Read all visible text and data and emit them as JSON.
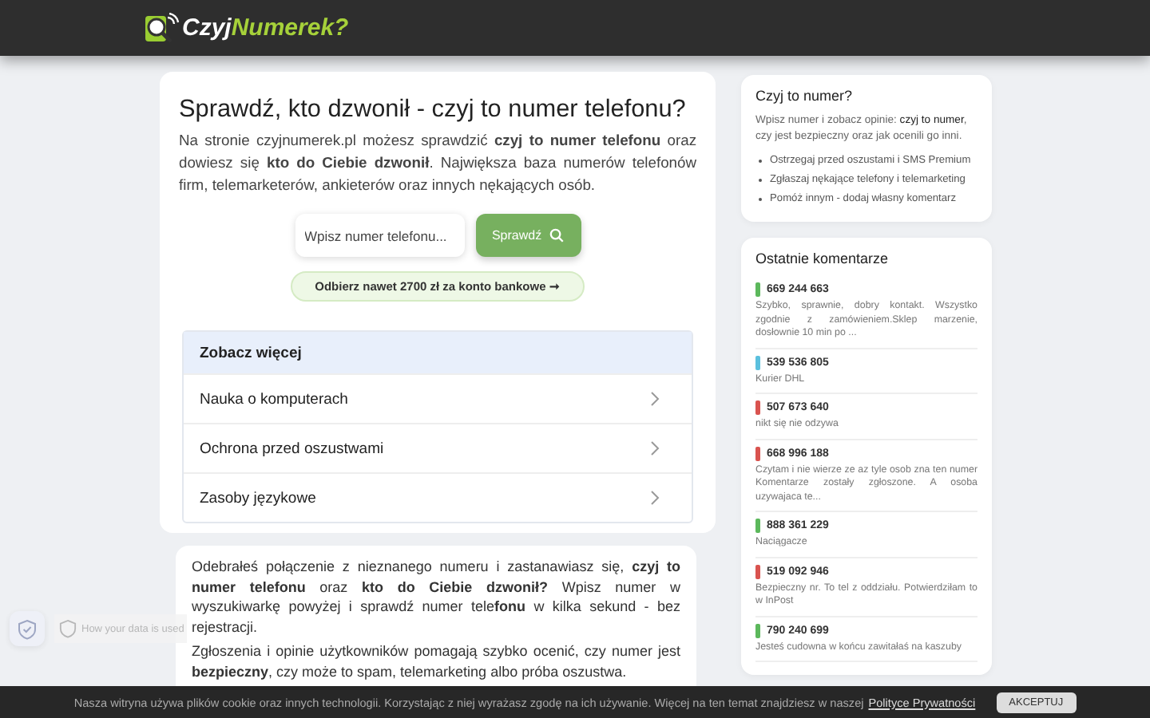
{
  "header": {
    "logo": {
      "part1": "Czyj",
      "part2": "Numerek?"
    }
  },
  "hero": {
    "title": "Sprawdź, kto dzwonił - czyj to numer telefonu?",
    "intro": "Na stronie czyjnumerek.pl możesz sprawdzić **czyj to numer telefonu** oraz dowiesz się **kto do Ciebie dzwonił**. Największa baza numerów telefonów firm, telemarketerów, ankieterów oraz innych nękających osób.",
    "search": {
      "placeholder": "Wpisz numer telefonu..."
    },
    "search_button": "Sprawdź",
    "promo": "Odbierz nawet 2700 zł za konto bankowe ➞"
  },
  "see_more": {
    "title": "Zobacz więcej",
    "items": [
      "Nauka o komputerach",
      "Ochrona przed oszustwami",
      "Zasoby językowe"
    ]
  },
  "article": {
    "paragraphs": [
      "Odebrałeś połączenie z nieznanego numeru i zastanawiasz się, **czyj to numer telefonu** oraz **kto do Ciebie dzwonił?** Wpisz numer w wyszukiwarkę powyżej i sprawdź numer tele**fonu** w kilka sekund - bez rejestracji.",
      "Zgłoszenia i opinie użytkowników pomagają szybko ocenić, czy numer jest **bezpieczny**, czy może to spam, telemarketing albo próba oszustwa."
    ]
  },
  "sidebar": {
    "info": {
      "title": "Czyj to numer?",
      "text": "Wpisz numer i zobacz opinie: **czyj to numer**, czy jest bezpieczny oraz jak ocenili go inni.",
      "bullets": [
        "Ostrzegaj przed oszustami i SMS Premium",
        "Zgłaszaj nękające telefony i telemarketing",
        "Pomóż innym - dodaj własny komentarz"
      ]
    },
    "comments": {
      "title": "Ostatnie komentarze",
      "items": [
        {
          "number": "669 244 663",
          "color": "#5cb85c",
          "text": "Szybko, sprawnie, dobry kontakt. Wszystko zgodnie z zamówieniem.Sklep marzenie, dosłownie 10 min po ..."
        },
        {
          "number": "539 536 805",
          "color": "#5bc0de",
          "text": "Kurier DHL"
        },
        {
          "number": "507 673 640",
          "color": "#d9534f",
          "text": "nikt się nie odzywa"
        },
        {
          "number": "668 996 188",
          "color": "#d9534f",
          "text": "Czytam i nie wierze ze az tyle osob zna ten numer Komentarze zostały zgłoszone. A osoba uzywajaca te..."
        },
        {
          "number": "888 361 229",
          "color": "#5cb85c",
          "text": "Naciągacze"
        },
        {
          "number": "519 092 946",
          "color": "#d9534f",
          "text": "Bezpieczny nr. To tel z oddziału. Potwierdziłam to w InPost"
        },
        {
          "number": "790 240 699",
          "color": "#5cb85c",
          "text": "Jesteś cudowna w końcu zawitałaś na kaszuby"
        }
      ]
    }
  },
  "privacy_popup": {
    "title": "How your data is used"
  },
  "cookie_bar": {
    "text": "Nasza witryna używa plików cookie oraz innych technologii. Korzystając z niej wyrażasz zgodę na ich używanie. Więcej na ten temat znajdziesz w naszej",
    "link": "Polityce Prywatności",
    "button": "AKCEPTUJ"
  }
}
